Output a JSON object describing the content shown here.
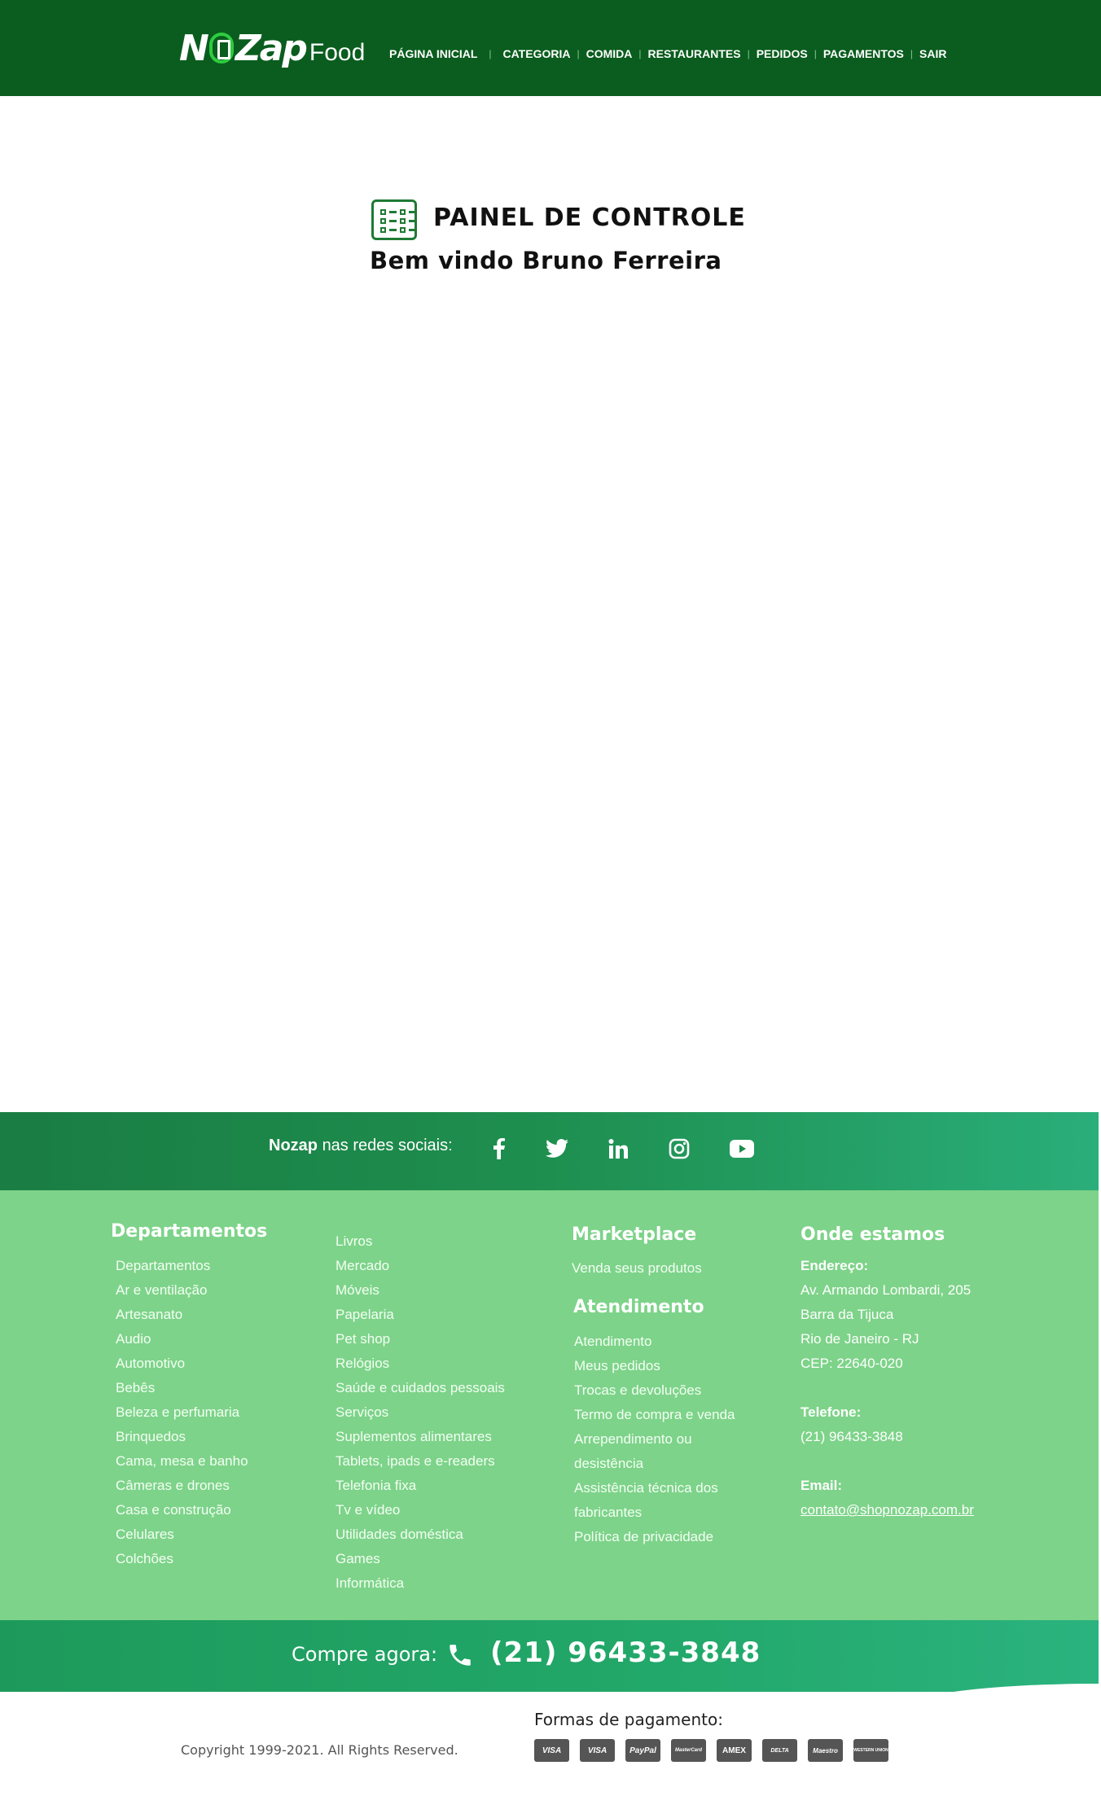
{
  "header": {
    "logo_text": "NOZap",
    "logo_sub": "Food",
    "nav": [
      {
        "label": "PÁGINA INICIAL"
      },
      {
        "label": "CATEGORIA"
      },
      {
        "label": "COMIDA"
      },
      {
        "label": "RESTAURANTES"
      },
      {
        "label": "PEDIDOS"
      },
      {
        "label": "PAGAMENTOS"
      },
      {
        "label": "SAIR"
      }
    ]
  },
  "main": {
    "panel_title": "PAINEL DE CONTROLE",
    "welcome": "Bem vindo Bruno Ferreira",
    "panel_icon": "checklist-icon"
  },
  "social": {
    "brand": "Nozap",
    "text": "nas redes sociais:",
    "icons": [
      "facebook-icon",
      "twitter-icon",
      "linkedin-icon",
      "instagram-icon",
      "youtube-icon"
    ]
  },
  "footer": {
    "departments": {
      "title": "Departamentos",
      "col1": [
        "Departamentos",
        "Ar e ventilação",
        "Artesanato",
        "Audio",
        "Automotivo",
        "Bebês",
        "Beleza e perfumaria",
        "Brinquedos",
        "Cama, mesa e banho",
        "Câmeras e drones",
        "Casa e construção",
        "Celulares",
        "Colchões"
      ],
      "col2": [
        "Livros",
        "Mercado",
        "Móveis",
        "Papelaria",
        "Pet shop",
        "Relógios",
        "Saúde e cuidados pessoais",
        "Serviços",
        "Suplementos alimentares",
        "Tablets, ipads e e-readers",
        "Telefonia fixa",
        "Tv e vídeo",
        "Utilidades doméstica",
        "Games",
        "Informática"
      ]
    },
    "marketplace": {
      "title": "Marketplace",
      "items": [
        "Venda seus produtos"
      ]
    },
    "atendimento": {
      "title": "Atendimento",
      "items": [
        "Atendimento",
        "Meus pedidos",
        "Trocas e devoluções",
        "Termo de compra e venda",
        "Arrependimento ou",
        "desistência",
        "Assistência técnica dos",
        "fabricantes",
        "Política de privacidade"
      ]
    },
    "location": {
      "title": "Onde estamos",
      "address_label": "Endereço:",
      "address_lines": [
        "Av. Armando Lombardi, 205",
        "Barra da Tijuca",
        "Rio de Janeiro - RJ",
        "CEP: 22640-020"
      ],
      "phone_label": "Telefone:",
      "phone": "(21) 96433-3848",
      "email_label": "Email:",
      "email": "contato@shopnozap.com.br"
    }
  },
  "phonebar": {
    "label": "Compre agora:",
    "number": "(21) 96433-3848"
  },
  "bottom": {
    "copyright": "Copyright 1999-2021. All Rights Reserved.",
    "payment_title": "Formas de pagamento:",
    "payment_methods": [
      "VISA",
      "VISA",
      "PayPal",
      "MasterCard",
      "AMEX",
      "DELTA",
      "Maestro",
      "WESTERN UNION"
    ]
  }
}
